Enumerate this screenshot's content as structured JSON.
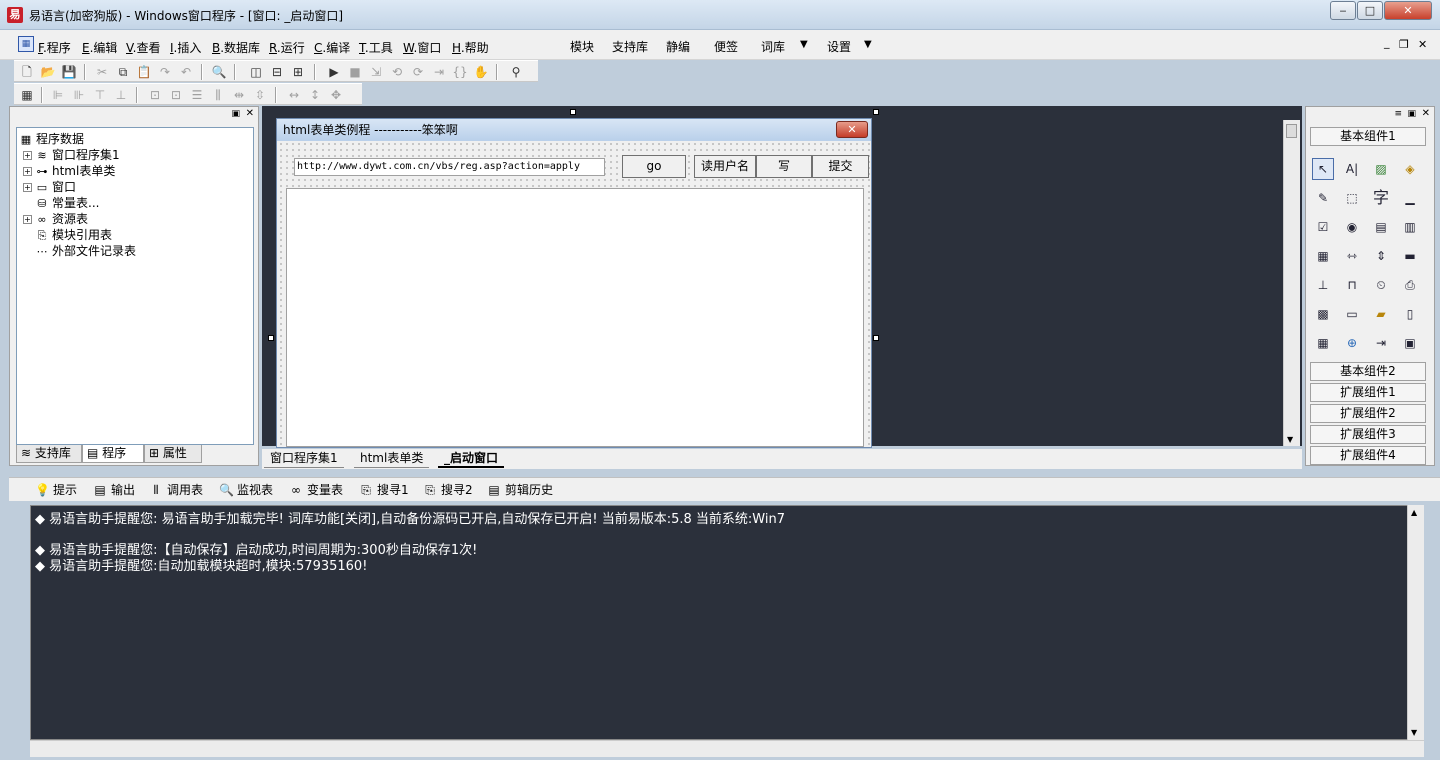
{
  "window": {
    "title": "易语言(加密狗版) - Windows窗口程序 - [窗口: _启动窗口]",
    "app_icon": "易",
    "btn_min": "‒",
    "btn_max": "□",
    "btn_close": "✕"
  },
  "menu": {
    "items": [
      {
        "key": "F",
        "label": ".程序"
      },
      {
        "key": "E",
        "label": ".编辑"
      },
      {
        "key": "V",
        "label": ".查看"
      },
      {
        "key": "I",
        "label": ".插入"
      },
      {
        "key": "B",
        "label": ".数据库"
      },
      {
        "key": "R",
        "label": ".运行"
      },
      {
        "key": "C",
        "label": ".编译"
      },
      {
        "key": "T",
        "label": ".工具"
      },
      {
        "key": "W",
        "label": ".窗口"
      },
      {
        "key": "H",
        "label": ".帮助"
      }
    ],
    "right": [
      "模块",
      "支持库",
      "静编",
      "便签",
      "词库",
      "设置"
    ],
    "dropdown_arrow": "▼"
  },
  "tree": {
    "root": "程序数据",
    "nodes": [
      "窗口程序集1",
      "html表单类",
      "窗口",
      "常量表...",
      "资源表",
      "模块引用表",
      "外部文件记录表"
    ]
  },
  "left_tabs": [
    "支持库",
    "程序",
    "属性"
  ],
  "form": {
    "title": "html表单类例程 -----------笨笨啊",
    "url": "http://www.dywt.com.cn/vbs/reg.asp?action=apply",
    "go_label": "go",
    "read_user_label": "读用户名",
    "write_label": "写",
    "submit_label": "提交"
  },
  "design_tabs": [
    "窗口程序集1",
    "html表单类",
    "_启动窗口"
  ],
  "palette": {
    "groups": [
      "基本组件1",
      "基本组件2",
      "扩展组件1",
      "扩展组件2",
      "扩展组件3",
      "扩展组件4"
    ],
    "char_icon": "字"
  },
  "bottom_tabs": [
    "提示",
    "输出",
    "调用表",
    "监视表",
    "变量表",
    "搜寻1",
    "搜寻2",
    "剪辑历史"
  ],
  "output": {
    "lines": [
      "◆  易语言助手提醒您:  易语言助手加载完毕!  词库功能[关闭],自动备份源码已开启,自动保存已开启!  当前易版本:5.8  当前系统:Win7",
      "◆  易语言助手提醒您:【自动保存】启动成功,时间周期为:300秒自动保存1次!",
      "◆  易语言助手提醒您:自动加载模块超时,模块:57935160!"
    ]
  }
}
